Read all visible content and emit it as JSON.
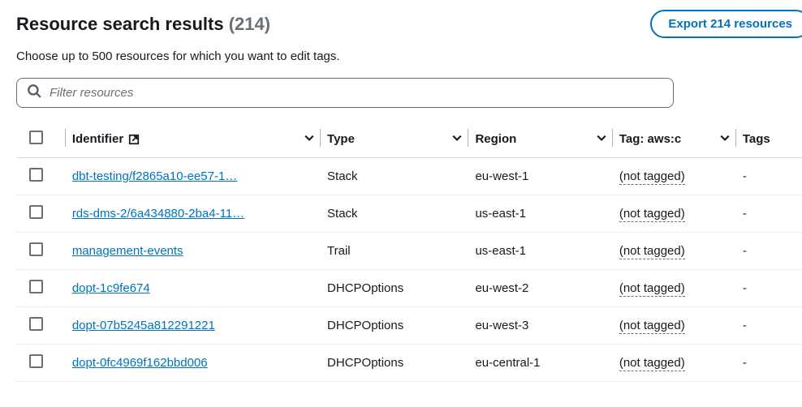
{
  "header": {
    "title_prefix": "Resource search results",
    "count_text": "(214)",
    "export_label": "Export 214 resources"
  },
  "subtitle": "Choose up to 500 resources for which you want to edit tags.",
  "filter": {
    "placeholder": "Filter resources"
  },
  "columns": {
    "identifier": "Identifier",
    "type": "Type",
    "region": "Region",
    "tag1": "Tag: aws:c",
    "tags": "Tags"
  },
  "not_tagged_label": "(not tagged)",
  "dash": "-",
  "rows": [
    {
      "identifier": "dbt-testing/f2865a10-ee57-1…",
      "type": "Stack",
      "region": "eu-west-1"
    },
    {
      "identifier": "rds-dms-2/6a434880-2ba4-11…",
      "type": "Stack",
      "region": "us-east-1"
    },
    {
      "identifier": "management-events",
      "type": "Trail",
      "region": "us-east-1"
    },
    {
      "identifier": "dopt-1c9fe674",
      "type": "DHCPOptions",
      "region": "eu-west-2"
    },
    {
      "identifier": "dopt-07b5245a812291221",
      "type": "DHCPOptions",
      "region": "eu-west-3"
    },
    {
      "identifier": "dopt-0fc4969f162bbd006",
      "type": "DHCPOptions",
      "region": "eu-central-1"
    }
  ]
}
